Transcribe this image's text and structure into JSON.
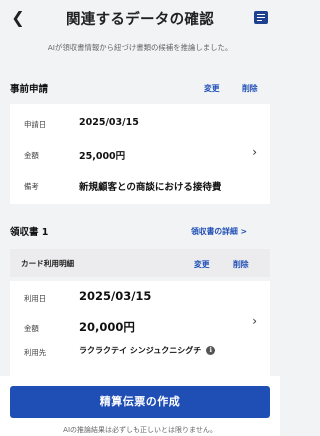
{
  "header": {
    "back_icon": "chevron-left-icon",
    "title": "関連するデータの確認",
    "memo_icon": "memo-icon",
    "subtitle": "AIが領収書情報から紐づけ書類の候補を推論しました。"
  },
  "pre_application": {
    "title": "事前申請",
    "change_label": "変更",
    "delete_label": "削除",
    "rows": [
      {
        "label": "申請日",
        "value": "2025/03/15"
      },
      {
        "label": "金額",
        "value": "25,000円"
      },
      {
        "label": "備考",
        "value": "新規顧客との商談における接待費"
      }
    ]
  },
  "receipt": {
    "title": "領収書 1",
    "detail_link": "領収書の詳細 >",
    "sub_title": "カード利用明細",
    "change_label": "変更",
    "delete_label": "削除",
    "rows": [
      {
        "label": "利用日",
        "value": "2025/03/15"
      },
      {
        "label": "金額",
        "value": "20,000円"
      },
      {
        "label": "利用先",
        "value": "ラクラクテイ シンジュクニシグチ"
      }
    ]
  },
  "footer": {
    "cta_label": "精算伝票の作成",
    "note": "AIの推論結果は必ずしも正しいとは限りません。"
  },
  "colors": {
    "accent": "#1f4fb5",
    "background": "#f2f3f5"
  }
}
